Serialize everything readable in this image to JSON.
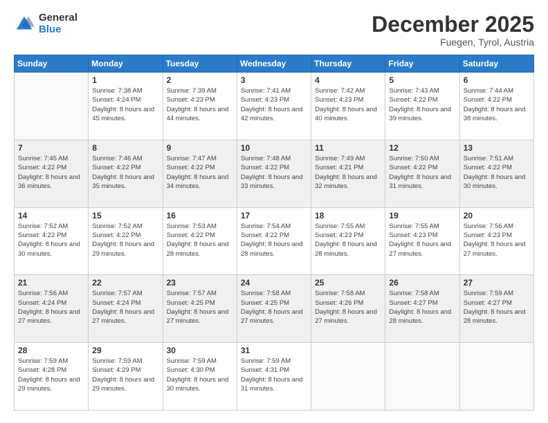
{
  "logo": {
    "general": "General",
    "blue": "Blue"
  },
  "header": {
    "month": "December 2025",
    "location": "Fuegen, Tyrol, Austria"
  },
  "weekdays": [
    "Sunday",
    "Monday",
    "Tuesday",
    "Wednesday",
    "Thursday",
    "Friday",
    "Saturday"
  ],
  "weeks": [
    [
      {
        "day": "",
        "sunrise": "",
        "sunset": "",
        "daylight": ""
      },
      {
        "day": "1",
        "sunrise": "Sunrise: 7:38 AM",
        "sunset": "Sunset: 4:24 PM",
        "daylight": "Daylight: 8 hours and 45 minutes."
      },
      {
        "day": "2",
        "sunrise": "Sunrise: 7:39 AM",
        "sunset": "Sunset: 4:23 PM",
        "daylight": "Daylight: 8 hours and 44 minutes."
      },
      {
        "day": "3",
        "sunrise": "Sunrise: 7:41 AM",
        "sunset": "Sunset: 4:23 PM",
        "daylight": "Daylight: 8 hours and 42 minutes."
      },
      {
        "day": "4",
        "sunrise": "Sunrise: 7:42 AM",
        "sunset": "Sunset: 4:23 PM",
        "daylight": "Daylight: 8 hours and 40 minutes."
      },
      {
        "day": "5",
        "sunrise": "Sunrise: 7:43 AM",
        "sunset": "Sunset: 4:22 PM",
        "daylight": "Daylight: 8 hours and 39 minutes."
      },
      {
        "day": "6",
        "sunrise": "Sunrise: 7:44 AM",
        "sunset": "Sunset: 4:22 PM",
        "daylight": "Daylight: 8 hours and 38 minutes."
      }
    ],
    [
      {
        "day": "7",
        "sunrise": "Sunrise: 7:45 AM",
        "sunset": "Sunset: 4:22 PM",
        "daylight": "Daylight: 8 hours and 36 minutes."
      },
      {
        "day": "8",
        "sunrise": "Sunrise: 7:46 AM",
        "sunset": "Sunset: 4:22 PM",
        "daylight": "Daylight: 8 hours and 35 minutes."
      },
      {
        "day": "9",
        "sunrise": "Sunrise: 7:47 AM",
        "sunset": "Sunset: 4:22 PM",
        "daylight": "Daylight: 8 hours and 34 minutes."
      },
      {
        "day": "10",
        "sunrise": "Sunrise: 7:48 AM",
        "sunset": "Sunset: 4:22 PM",
        "daylight": "Daylight: 8 hours and 33 minutes."
      },
      {
        "day": "11",
        "sunrise": "Sunrise: 7:49 AM",
        "sunset": "Sunset: 4:21 PM",
        "daylight": "Daylight: 8 hours and 32 minutes."
      },
      {
        "day": "12",
        "sunrise": "Sunrise: 7:50 AM",
        "sunset": "Sunset: 4:22 PM",
        "daylight": "Daylight: 8 hours and 31 minutes."
      },
      {
        "day": "13",
        "sunrise": "Sunrise: 7:51 AM",
        "sunset": "Sunset: 4:22 PM",
        "daylight": "Daylight: 8 hours and 30 minutes."
      }
    ],
    [
      {
        "day": "14",
        "sunrise": "Sunrise: 7:52 AM",
        "sunset": "Sunset: 4:22 PM",
        "daylight": "Daylight: 8 hours and 30 minutes."
      },
      {
        "day": "15",
        "sunrise": "Sunrise: 7:52 AM",
        "sunset": "Sunset: 4:22 PM",
        "daylight": "Daylight: 8 hours and 29 minutes."
      },
      {
        "day": "16",
        "sunrise": "Sunrise: 7:53 AM",
        "sunset": "Sunset: 4:22 PM",
        "daylight": "Daylight: 8 hours and 28 minutes."
      },
      {
        "day": "17",
        "sunrise": "Sunrise: 7:54 AM",
        "sunset": "Sunset: 4:22 PM",
        "daylight": "Daylight: 8 hours and 28 minutes."
      },
      {
        "day": "18",
        "sunrise": "Sunrise: 7:55 AM",
        "sunset": "Sunset: 4:23 PM",
        "daylight": "Daylight: 8 hours and 28 minutes."
      },
      {
        "day": "19",
        "sunrise": "Sunrise: 7:55 AM",
        "sunset": "Sunset: 4:23 PM",
        "daylight": "Daylight: 8 hours and 27 minutes."
      },
      {
        "day": "20",
        "sunrise": "Sunrise: 7:56 AM",
        "sunset": "Sunset: 4:23 PM",
        "daylight": "Daylight: 8 hours and 27 minutes."
      }
    ],
    [
      {
        "day": "21",
        "sunrise": "Sunrise: 7:56 AM",
        "sunset": "Sunset: 4:24 PM",
        "daylight": "Daylight: 8 hours and 27 minutes."
      },
      {
        "day": "22",
        "sunrise": "Sunrise: 7:57 AM",
        "sunset": "Sunset: 4:24 PM",
        "daylight": "Daylight: 8 hours and 27 minutes."
      },
      {
        "day": "23",
        "sunrise": "Sunrise: 7:57 AM",
        "sunset": "Sunset: 4:25 PM",
        "daylight": "Daylight: 8 hours and 27 minutes."
      },
      {
        "day": "24",
        "sunrise": "Sunrise: 7:58 AM",
        "sunset": "Sunset: 4:25 PM",
        "daylight": "Daylight: 8 hours and 27 minutes."
      },
      {
        "day": "25",
        "sunrise": "Sunrise: 7:58 AM",
        "sunset": "Sunset: 4:26 PM",
        "daylight": "Daylight: 8 hours and 27 minutes."
      },
      {
        "day": "26",
        "sunrise": "Sunrise: 7:58 AM",
        "sunset": "Sunset: 4:27 PM",
        "daylight": "Daylight: 8 hours and 28 minutes."
      },
      {
        "day": "27",
        "sunrise": "Sunrise: 7:59 AM",
        "sunset": "Sunset: 4:27 PM",
        "daylight": "Daylight: 8 hours and 28 minutes."
      }
    ],
    [
      {
        "day": "28",
        "sunrise": "Sunrise: 7:59 AM",
        "sunset": "Sunset: 4:28 PM",
        "daylight": "Daylight: 8 hours and 29 minutes."
      },
      {
        "day": "29",
        "sunrise": "Sunrise: 7:59 AM",
        "sunset": "Sunset: 4:29 PM",
        "daylight": "Daylight: 8 hours and 29 minutes."
      },
      {
        "day": "30",
        "sunrise": "Sunrise: 7:59 AM",
        "sunset": "Sunset: 4:30 PM",
        "daylight": "Daylight: 8 hours and 30 minutes."
      },
      {
        "day": "31",
        "sunrise": "Sunrise: 7:59 AM",
        "sunset": "Sunset: 4:31 PM",
        "daylight": "Daylight: 8 hours and 31 minutes."
      },
      {
        "day": "",
        "sunrise": "",
        "sunset": "",
        "daylight": ""
      },
      {
        "day": "",
        "sunrise": "",
        "sunset": "",
        "daylight": ""
      },
      {
        "day": "",
        "sunrise": "",
        "sunset": "",
        "daylight": ""
      }
    ]
  ]
}
